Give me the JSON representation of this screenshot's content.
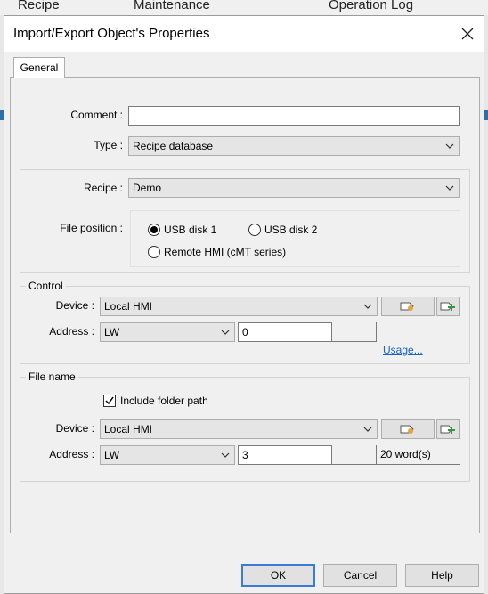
{
  "background": {
    "tabs": [
      "Recipe",
      "Maintenance",
      "Operation Log"
    ]
  },
  "dialog": {
    "title": "Import/Export Object's Properties",
    "tab": "General",
    "comment": {
      "label": "Comment :",
      "value": ""
    },
    "type": {
      "label": "Type :",
      "value": "Recipe database"
    },
    "recipe": {
      "label": "Recipe :",
      "value": "Demo"
    },
    "file_position": {
      "label": "File position :",
      "options": [
        "USB disk 1",
        "USB disk 2",
        "Remote HMI (cMT series)"
      ],
      "selected": "USB disk 1"
    },
    "control": {
      "title": "Control",
      "device_label": "Device :",
      "device_value": "Local HMI",
      "address_label": "Address :",
      "address_type": "LW",
      "address_value": "0",
      "usage_link": "Usage..."
    },
    "file_name": {
      "title": "File name",
      "include_folder_label": "Include folder path",
      "include_folder_checked": true,
      "device_label": "Device :",
      "device_value": "Local HMI",
      "address_label": "Address :",
      "address_type": "LW",
      "address_value": "3",
      "size_text": "20 word(s)"
    },
    "buttons": {
      "ok": "OK",
      "cancel": "Cancel",
      "help": "Help"
    }
  },
  "colors": {
    "accent": "#3a7bd5",
    "link": "#1a62c4",
    "bg_marker": "#2f6fa8"
  }
}
